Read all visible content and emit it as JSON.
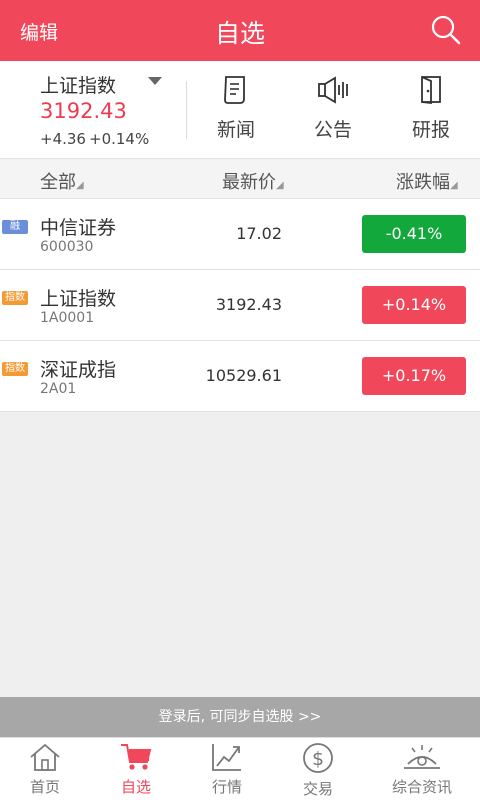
{
  "header": {
    "edit_label": "编辑",
    "title": "自选",
    "search_icon": "search-icon"
  },
  "index_panel": {
    "name": "上证指数",
    "price": "3192.43",
    "change": "+4.36",
    "change_pct": "+0.14%",
    "shortcuts": [
      {
        "label": "新闻",
        "icon": "news-icon"
      },
      {
        "label": "公告",
        "icon": "announcement-icon"
      },
      {
        "label": "研报",
        "icon": "research-report-icon"
      }
    ]
  },
  "columns": {
    "all": "全部",
    "latest_price": "最新价",
    "change_pct": "涨跌幅"
  },
  "stocks": [
    {
      "tag": "融",
      "name": "中信证券",
      "code": "600030",
      "price": "17.02",
      "change": "-0.41%",
      "trend": "down"
    },
    {
      "tag": "指数",
      "name": "上证指数",
      "code": "1A0001",
      "price": "3192.43",
      "change": "+0.14%",
      "trend": "up"
    },
    {
      "tag": "指数",
      "name": "深证成指",
      "code": "2A01",
      "price": "10529.61",
      "change": "+0.17%",
      "trend": "up"
    }
  ],
  "login_banner": "登录后, 可同步自选股 >>",
  "tabs": [
    {
      "label": "首页",
      "icon": "home-icon",
      "active": false
    },
    {
      "label": "自选",
      "icon": "cart-icon",
      "active": true
    },
    {
      "label": "行情",
      "icon": "chart-trend-icon",
      "active": false
    },
    {
      "label": "交易",
      "icon": "dollar-icon",
      "active": false
    },
    {
      "label": "综合资讯",
      "icon": "info-eye-icon",
      "active": false
    }
  ],
  "colors": {
    "brand": "#f0485a",
    "up": "#f0485a",
    "down": "#13a83c"
  }
}
